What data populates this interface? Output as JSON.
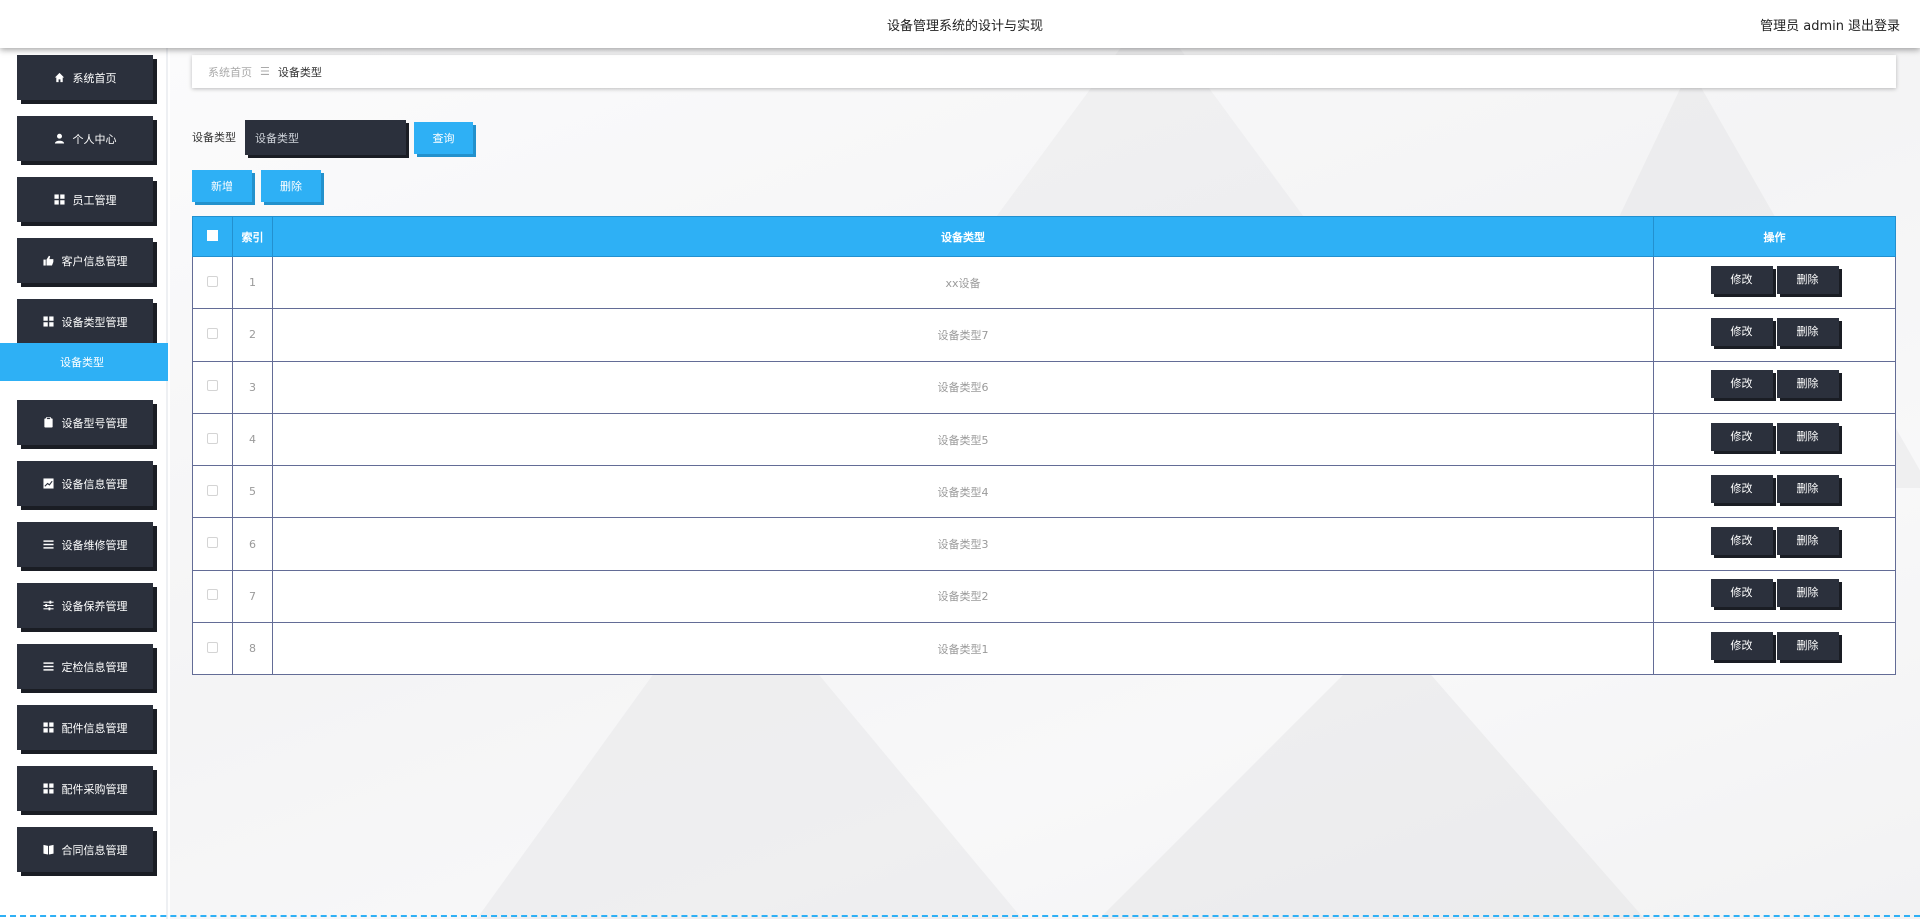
{
  "header": {
    "title": "设备管理系统的设计与实现",
    "user": "管理员 admin",
    "logout": "退出登录"
  },
  "sidebar": {
    "items": [
      {
        "label": "系统首页",
        "icon": "home-icon"
      },
      {
        "label": "个人中心",
        "icon": "user-icon"
      },
      {
        "label": "员工管理",
        "icon": "grid-icon"
      },
      {
        "label": "客户信息管理",
        "icon": "thumb-icon"
      },
      {
        "label": "设备类型管理",
        "icon": "grid-icon"
      },
      {
        "label": "设备型号管理",
        "icon": "clipboard-icon"
      },
      {
        "label": "设备信息管理",
        "icon": "chart-icon"
      },
      {
        "label": "设备维修管理",
        "icon": "list-icon"
      },
      {
        "label": "设备保养管理",
        "icon": "sliders-icon"
      },
      {
        "label": "定检信息管理",
        "icon": "list-icon"
      },
      {
        "label": "配件信息管理",
        "icon": "grid-icon"
      },
      {
        "label": "配件采购管理",
        "icon": "grid-icon"
      },
      {
        "label": "合同信息管理",
        "icon": "book-icon"
      }
    ],
    "active_sub": "设备类型"
  },
  "breadcrumb": {
    "home": "系统首页",
    "separator": "☰",
    "current": "设备类型"
  },
  "search": {
    "label": "设备类型",
    "placeholder": "设备类型",
    "button": "查询"
  },
  "toolbar": {
    "add": "新增",
    "delete": "删除"
  },
  "table": {
    "columns": [
      "索引",
      "设备类型",
      "操作"
    ],
    "rows": [
      {
        "index": "1",
        "type": "xx设备"
      },
      {
        "index": "2",
        "type": "设备类型7"
      },
      {
        "index": "3",
        "type": "设备类型6"
      },
      {
        "index": "4",
        "type": "设备类型5"
      },
      {
        "index": "5",
        "type": "设备类型4"
      },
      {
        "index": "6",
        "type": "设备类型3"
      },
      {
        "index": "7",
        "type": "设备类型2"
      },
      {
        "index": "8",
        "type": "设备类型1"
      }
    ],
    "edit_label": "修改",
    "delete_label": "删除"
  },
  "colors": {
    "accent": "#2eb0f5",
    "dark": "#2b303c"
  }
}
